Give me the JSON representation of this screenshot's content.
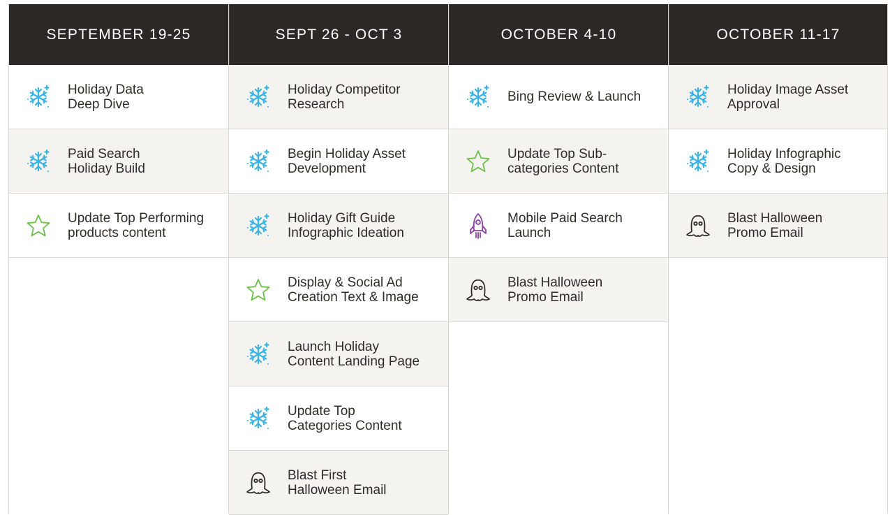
{
  "colors": {
    "header_bg": "#2b2825",
    "header_text": "#ffffff",
    "cell_shade": "#f4f3f0",
    "cell_plain": "#ffffff",
    "snowflake": "#3bb3e3",
    "star": "#6dbf4b",
    "rocket": "#8e3fa4",
    "ghost": "#2f2c2a"
  },
  "columns": [
    {
      "title": "SEPTEMBER 19-25",
      "tasks": [
        {
          "icon": "snowflake-icon",
          "label": "Holiday Data\nDeep Dive",
          "shade": false
        },
        {
          "icon": "snowflake-icon",
          "label": "Paid Search\nHoliday Build",
          "shade": true
        },
        {
          "icon": "star-icon",
          "label": "Update Top Performing\nproducts content",
          "shade": false
        }
      ]
    },
    {
      "title": "SEPT 26 - OCT 3",
      "tasks": [
        {
          "icon": "snowflake-icon",
          "label": "Holiday Competitor\nResearch",
          "shade": true
        },
        {
          "icon": "snowflake-icon",
          "label": "Begin Holiday Asset\nDevelopment",
          "shade": false
        },
        {
          "icon": "snowflake-icon",
          "label": "Holiday Gift Guide\nInfographic Ideation",
          "shade": true
        },
        {
          "icon": "star-icon",
          "label": "Display & Social Ad\nCreation Text & Image",
          "shade": false
        },
        {
          "icon": "snowflake-icon",
          "label": "Launch Holiday\nContent Landing Page",
          "shade": true
        },
        {
          "icon": "snowflake-icon",
          "label": "Update Top\nCategories Content",
          "shade": false
        },
        {
          "icon": "ghost-icon",
          "label": "Blast First\nHalloween Email",
          "shade": true
        }
      ]
    },
    {
      "title": "OCTOBER 4-10",
      "tasks": [
        {
          "icon": "snowflake-icon",
          "label": "Bing Review & Launch",
          "shade": false
        },
        {
          "icon": "star-icon",
          "label": "Update Top Sub-\ncategories Content",
          "shade": true
        },
        {
          "icon": "rocket-icon",
          "label": "Mobile Paid Search\nLaunch",
          "shade": false
        },
        {
          "icon": "ghost-icon",
          "label": "Blast Halloween\nPromo Email",
          "shade": true
        }
      ]
    },
    {
      "title": "OCTOBER 11-17",
      "tasks": [
        {
          "icon": "snowflake-icon",
          "label": "Holiday Image Asset\nApproval",
          "shade": true
        },
        {
          "icon": "snowflake-icon",
          "label": "Holiday Infographic\nCopy & Design",
          "shade": false
        },
        {
          "icon": "ghost-icon",
          "label": "Blast Halloween\nPromo Email",
          "shade": true
        }
      ]
    }
  ]
}
